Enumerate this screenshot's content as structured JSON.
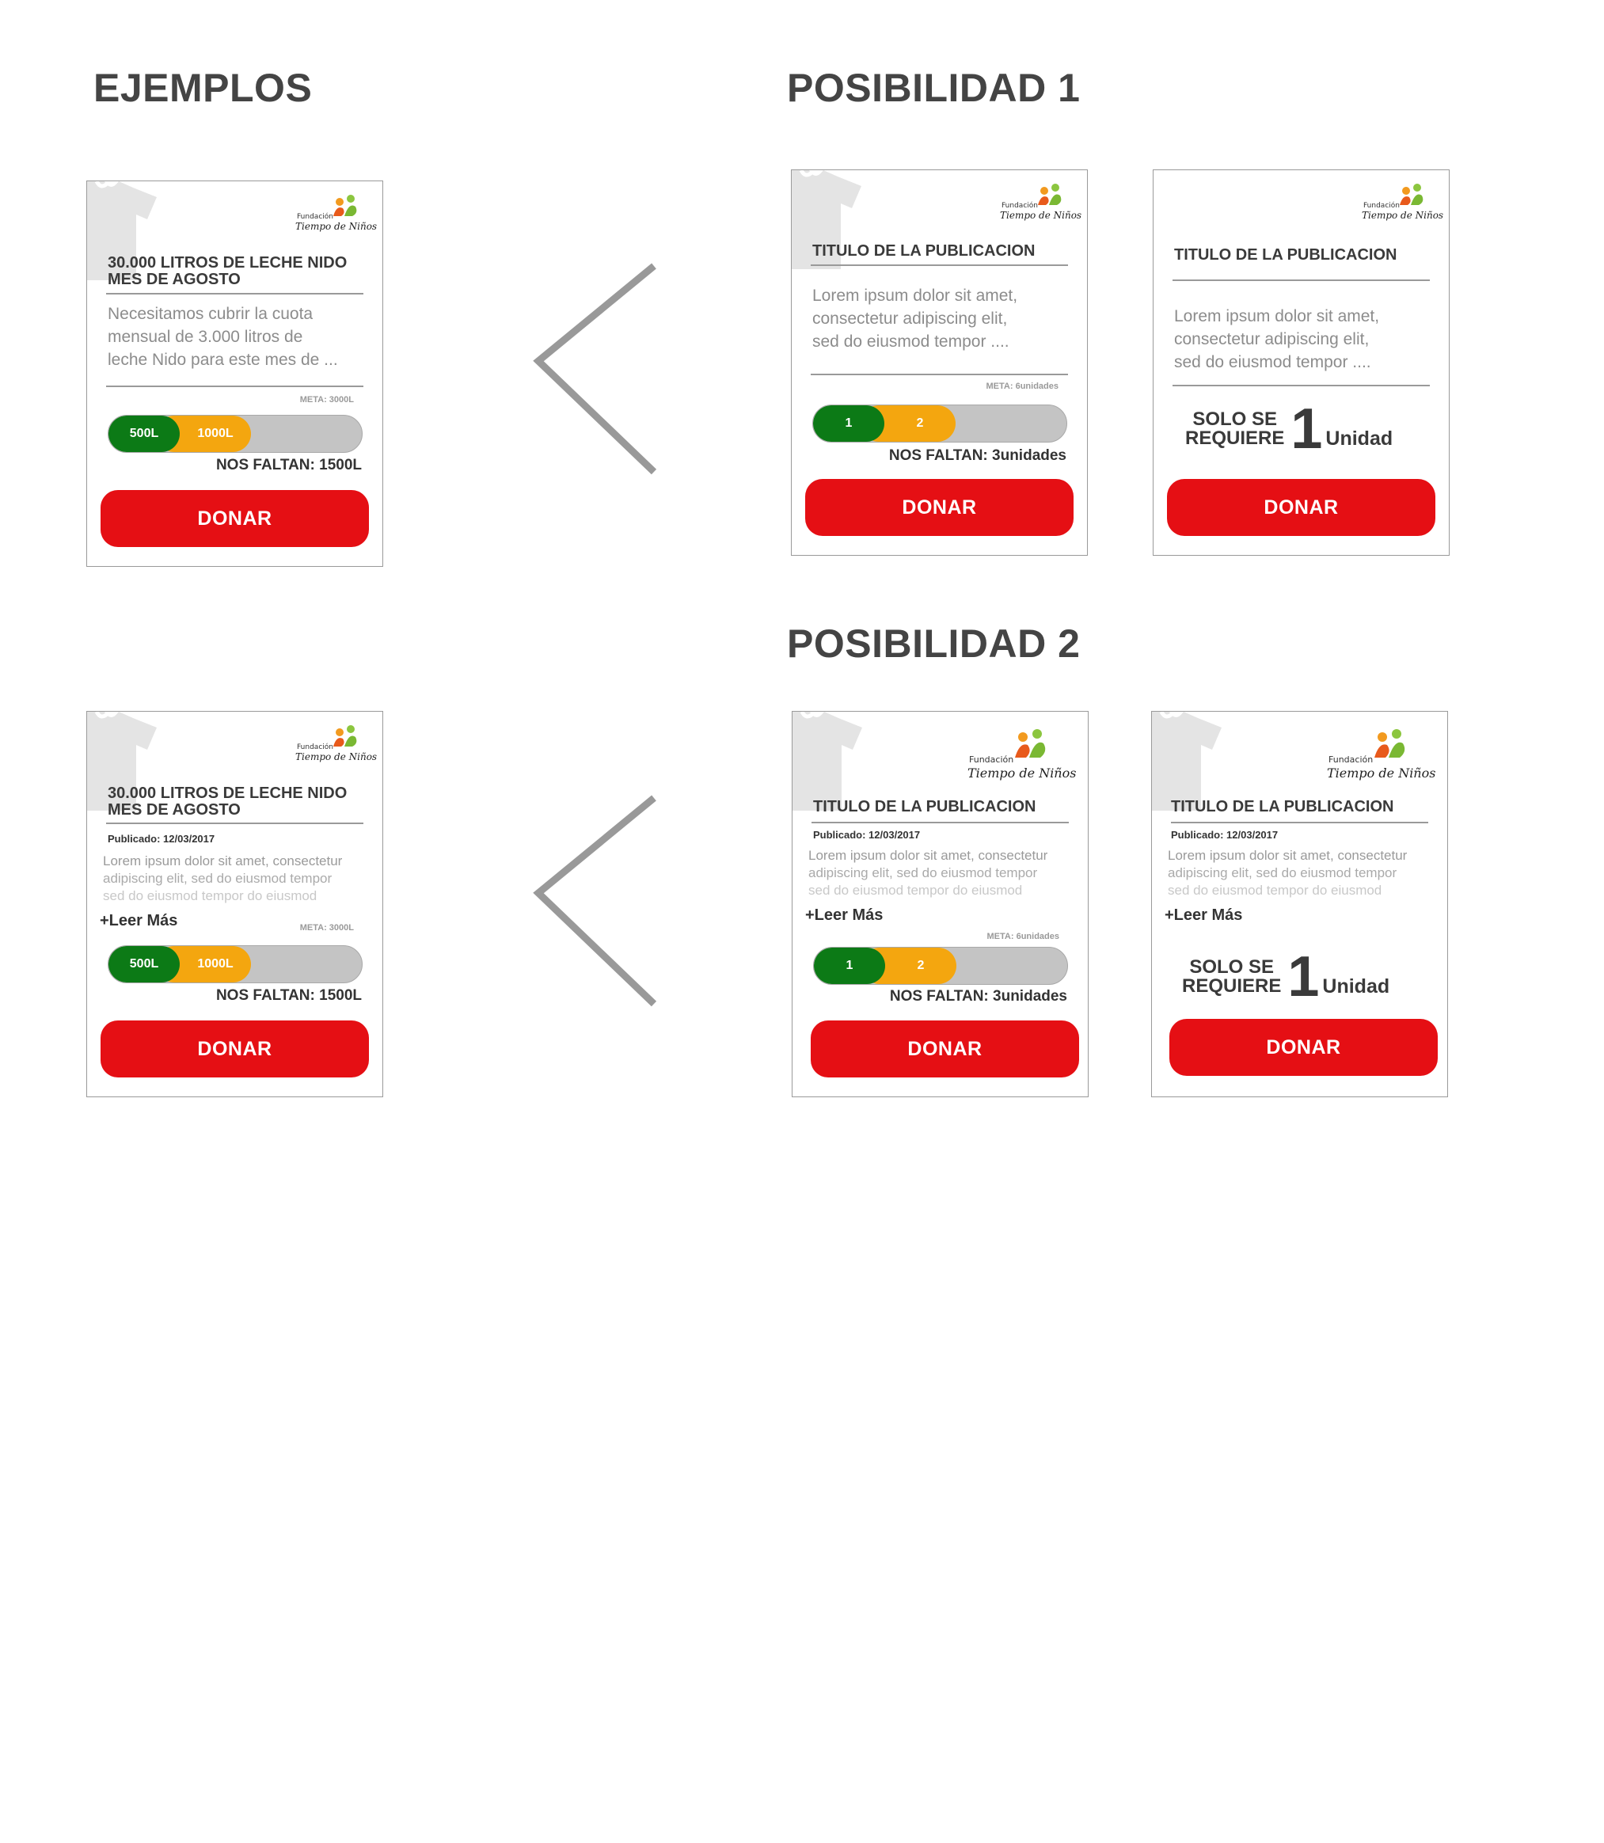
{
  "headings": {
    "ejemplos": "EJEMPLOS",
    "posibilidad1": "POSIBILIDAD 1",
    "posibilidad2": "POSIBILIDAD 2"
  },
  "logo": {
    "fundacion": "Fundación",
    "tiempo": "Tiempo de Niños"
  },
  "colors": {
    "accent_red": "#e50f14",
    "progress_green": "#0c7a16",
    "progress_orange": "#f4a60f",
    "track_gray": "#c4c4c4"
  },
  "icons": {
    "product": "tshirt-icon",
    "logo": "fundacion-logo",
    "arrow": "chevron-left-icon"
  },
  "ex1": {
    "title_line1": "30.000 LITROS DE LECHE NIDO",
    "title_line2": "MES DE AGOSTO",
    "desc_line1": "Necesitamos cubrir la cuota",
    "desc_line2": "mensual de 3.000 litros de",
    "desc_line3": "leche Nido para este mes de ...",
    "meta": "META: 3000L",
    "seg1": "500L",
    "seg2": "1000L",
    "faltan": "NOS FALTAN: 1500L",
    "donar": "DONAR"
  },
  "p1a": {
    "title": "TITULO DE LA PUBLICACION",
    "desc_line1": "Lorem ipsum dolor sit amet,",
    "desc_line2": " consectetur adipiscing elit,",
    "desc_line3": "sed do eiusmod tempor ....",
    "meta": "META: 6unidades",
    "seg1": "1",
    "seg2": "2",
    "faltan": "NOS FALTAN: 3unidades",
    "donar": "DONAR"
  },
  "p1b": {
    "title": "TITULO DE LA PUBLICACION",
    "desc_line1": "Lorem ipsum dolor sit amet,",
    "desc_line2": " consectetur adipiscing elit,",
    "desc_line3": "sed do eiusmod tempor ....",
    "solo_line1": "SOLO SE",
    "solo_line2": "REQUIERE",
    "solo_num": "1",
    "solo_unit": "Unidad",
    "donar": "DONAR"
  },
  "ex2": {
    "title_line1": "30.000 LITROS DE LECHE NIDO",
    "title_line2": "MES DE AGOSTO",
    "published": "Publicado: 12/03/2017",
    "desc_line1": "Lorem ipsum dolor sit amet,  consectetur",
    "desc_line2": " adipiscing elit, sed do eiusmod tempor",
    "desc_line3": "sed do eiusmod tempor do eiusmod",
    "leer": "+Leer Más",
    "meta": "META: 3000L",
    "seg1": "500L",
    "seg2": "1000L",
    "faltan": "NOS FALTAN: 1500L",
    "donar": "DONAR"
  },
  "p2a": {
    "title": "TITULO DE LA PUBLICACION",
    "published": "Publicado: 12/03/2017",
    "desc_line1": "Lorem ipsum dolor sit amet,  consectetur",
    "desc_line2": " adipiscing elit, sed do eiusmod tempor",
    "desc_line3": "sed do eiusmod tempor do eiusmod",
    "leer": "+Leer Más",
    "meta": "META: 6unidades",
    "seg1": "1",
    "seg2": "2",
    "faltan": "NOS FALTAN: 3unidades",
    "donar": "DONAR"
  },
  "p2b": {
    "title": "TITULO DE LA PUBLICACION",
    "published": "Publicado: 12/03/2017",
    "desc_line1": "Lorem ipsum dolor sit amet,  consectetur",
    "desc_line2": " adipiscing elit, sed do eiusmod tempor",
    "desc_line3": "sed do eiusmod tempor do eiusmod",
    "leer": "+Leer Más",
    "solo_line1": "SOLO SE",
    "solo_line2": "REQUIERE",
    "solo_num": "1",
    "solo_unit": "Unidad",
    "donar": "DONAR"
  }
}
